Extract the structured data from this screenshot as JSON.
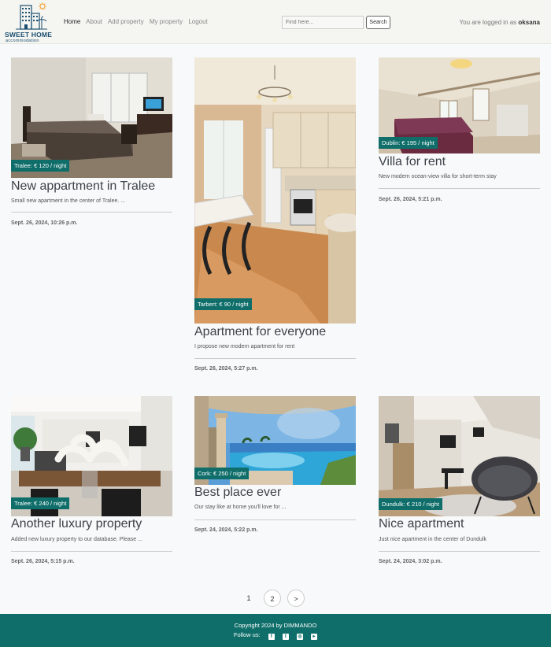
{
  "header": {
    "brand": "SWEET HOME",
    "brand_sub": "accommodation",
    "nav": [
      "Home",
      "About",
      "Add property",
      "My property",
      "Logout"
    ],
    "search_placeholder": "Find here...",
    "search_button": "Search",
    "login_prefix": "You are logged in as",
    "username": "oksana"
  },
  "cards": [
    {
      "badge": "Tralee: € 120 / night",
      "title": "New appartment in Tralee",
      "desc": "Small new apartment in the center of Tralee. ...",
      "date": "Sept. 26, 2024, 10:26 p.m."
    },
    {
      "badge": "Tarbert: € 90 / night",
      "title": "Apartment for everyone",
      "desc": "I propose new modern apartment for rent",
      "date": "Sept. 26, 2024, 5:27 p.m."
    },
    {
      "badge": "Dublin: € 195 / night",
      "title": "Villa for rent",
      "desc": "New modern ocean-view villa for short-term stay",
      "date": "Sept. 26, 2024, 5:21 p.m."
    },
    {
      "badge": "Tralee: € 240 / night",
      "title": "Another luxury property",
      "desc": "Added new luxury property to our database. Please ...",
      "date": "Sept. 26, 2024, 5:15 p.m."
    },
    {
      "badge": "Cork: € 250 / night",
      "title": "Best place ever",
      "desc": "Our stay like at home you'll love for ...",
      "date": "Sept. 24, 2024, 5:22 p.m."
    },
    {
      "badge": "Dundulk: € 210 / night",
      "title": "Nice apartment",
      "desc": "Just nice apartment in the center of Dundulk",
      "date": "Sept. 24, 2024, 3:02 p.m."
    }
  ],
  "pagination": {
    "current": "1",
    "next_page": "2",
    "next": ">"
  },
  "footer": {
    "copyright": "Copyright 2024 by DIMMANDO",
    "follow": "Follow us:",
    "social_icons": [
      "facebook-icon",
      "twitter-icon",
      "instagram-icon",
      "youtube-icon"
    ]
  },
  "colors": {
    "accent": "#0f6e6a",
    "brand": "#1b4f72"
  }
}
